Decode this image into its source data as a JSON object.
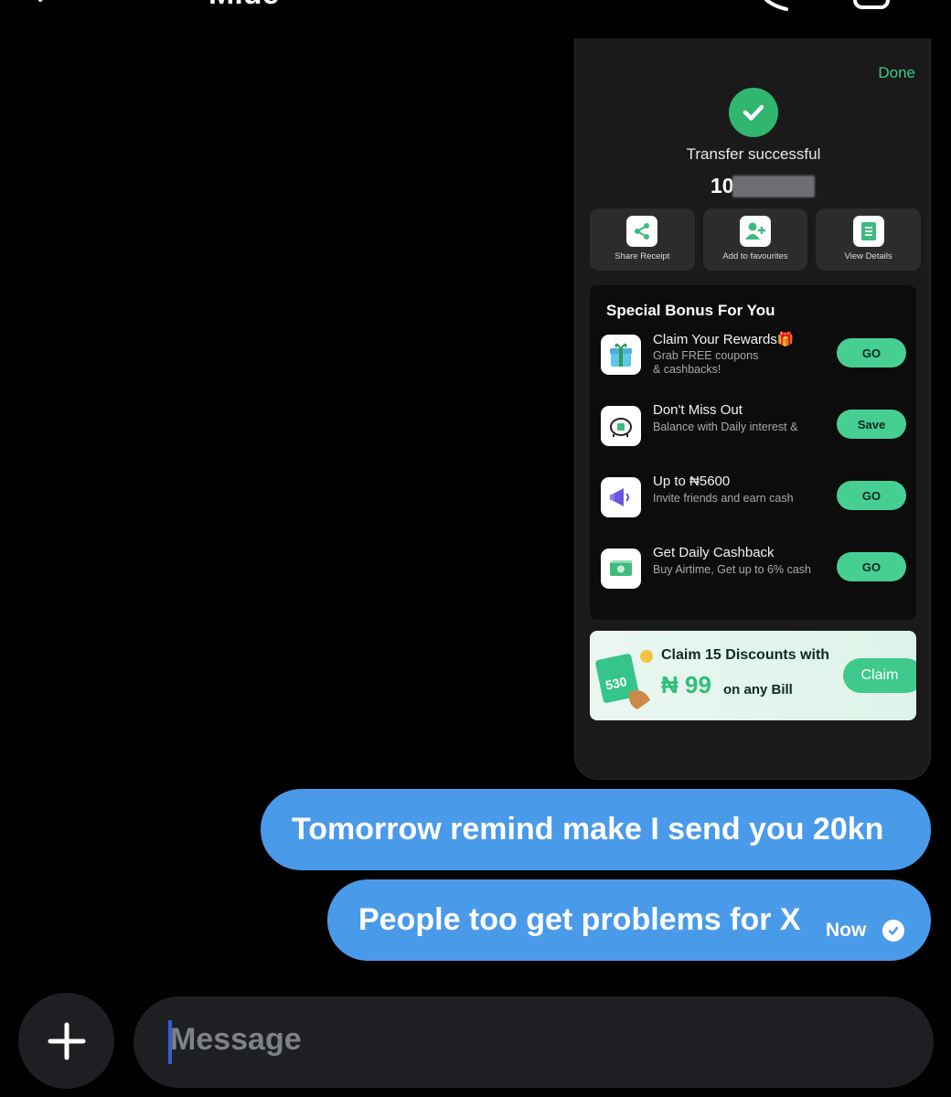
{
  "header": {
    "chat_name": "Mide"
  },
  "shared_image": {
    "done_label": "Done",
    "transfer_status": "Transfer successful",
    "amount_visible": "10",
    "actions": [
      {
        "label": "Share Receipt",
        "icon": "share-icon"
      },
      {
        "label": "Add to favourites",
        "icon": "add-user-icon"
      },
      {
        "label": "View Details",
        "icon": "document-icon"
      }
    ],
    "bonus": {
      "title": "Special Bonus For You",
      "items": [
        {
          "name": "Claim Your Rewards🎁",
          "desc": "Grab FREE coupons & cashbacks!",
          "button": "GO",
          "icon": "gift-icon"
        },
        {
          "name": "Don't Miss Out",
          "desc": "Balance with Daily interest &",
          "button": "Save",
          "icon": "piggy-bank-icon"
        },
        {
          "name": "Up to ₦5600",
          "desc": "Invite friends and earn cash",
          "button": "GO",
          "icon": "megaphone-icon"
        },
        {
          "name": "Get Daily Cashback",
          "desc": "Buy Airtime, Get up to 6% cash",
          "button": "GO",
          "icon": "cash-icon"
        }
      ]
    },
    "promo": {
      "line1": "Claim 15 Discounts with",
      "price": "₦ 99",
      "suffix": "on any Bill",
      "voucher_number": "530",
      "claim_label": "Claim"
    }
  },
  "messages": [
    {
      "text": "Tomorrow remind make I send you 20kn"
    },
    {
      "text": "People too get problems for X",
      "time": "Now"
    }
  ],
  "composer": {
    "placeholder": "Message"
  },
  "colors": {
    "bubble": "#4a9aea",
    "accent_green": "#47cf93",
    "background": "#000000"
  }
}
